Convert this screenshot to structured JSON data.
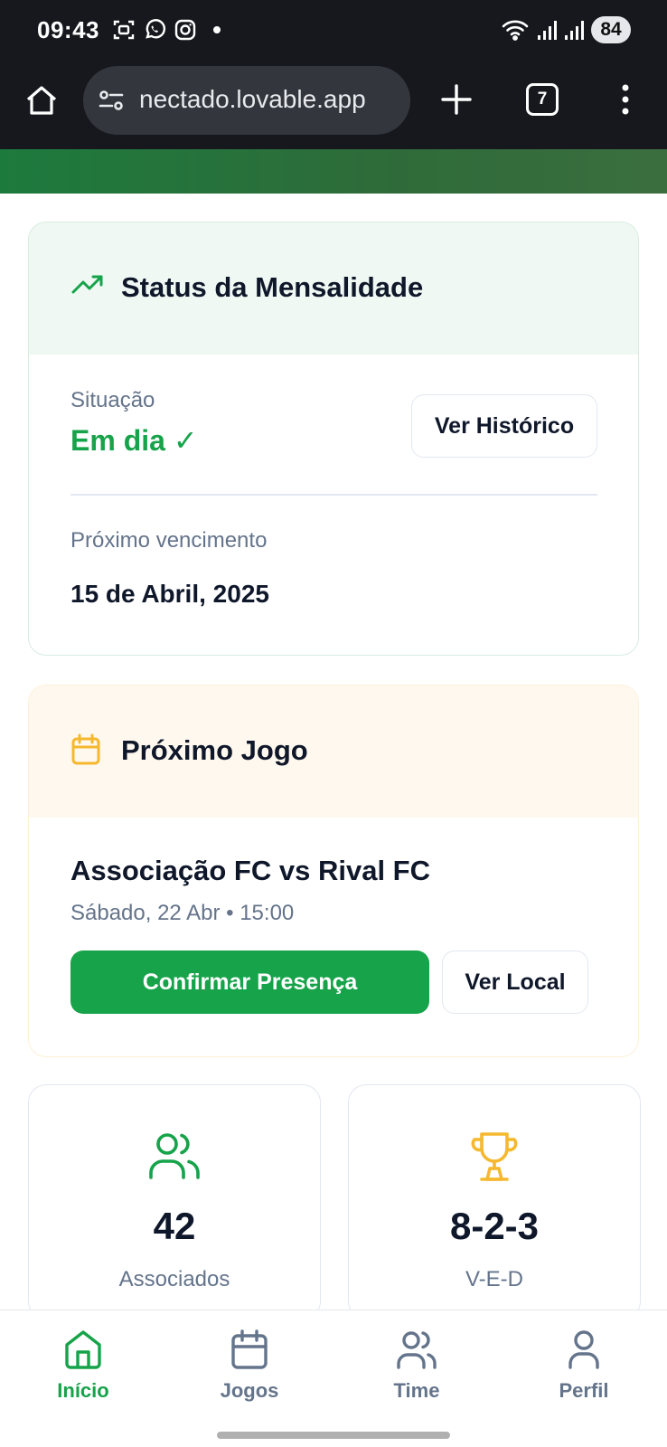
{
  "status_bar": {
    "time": "09:43",
    "battery": "84",
    "left_icons": [
      "screenshot-icon",
      "whatsapp-icon",
      "instagram-icon",
      "notification-dot"
    ],
    "right_icons": [
      "wifi-icon",
      "signal-icon",
      "signal-icon"
    ]
  },
  "browser": {
    "url": "nectado.lovable.app",
    "tab_count": "7"
  },
  "status_card": {
    "title": "Status da Mensalidade",
    "situation_label": "Situação",
    "situation_value": "Em dia ✓",
    "history_button": "Ver Histórico",
    "due_label": "Próximo vencimento",
    "due_value": "15 de Abril, 2025"
  },
  "game_card": {
    "title": "Próximo Jogo",
    "match": "Associação FC vs Rival FC",
    "datetime": "Sábado, 22 Abr • 15:00",
    "confirm_button": "Confirmar Presença",
    "location_button": "Ver Local"
  },
  "stats": [
    {
      "value": "42",
      "label": "Associados",
      "icon": "users-icon"
    },
    {
      "value": "8-2-3",
      "label": "V-E-D",
      "icon": "trophy-icon"
    }
  ],
  "bottom_nav": [
    {
      "label": "Início",
      "icon": "home-icon",
      "active": true
    },
    {
      "label": "Jogos",
      "icon": "calendar-icon",
      "active": false
    },
    {
      "label": "Time",
      "icon": "users-icon",
      "active": false
    },
    {
      "label": "Perfil",
      "icon": "user-icon",
      "active": false
    }
  ],
  "colors": {
    "primary_green": "#16a34a",
    "amber": "#f5b82e",
    "muted_text": "#64748b",
    "browser_chrome": "#16181d"
  }
}
